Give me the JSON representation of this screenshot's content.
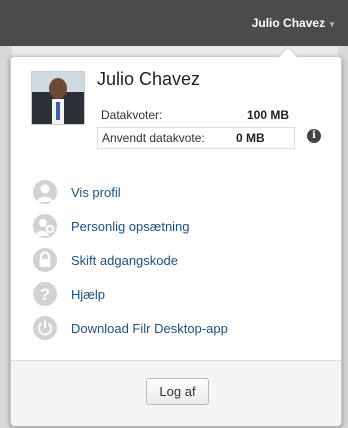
{
  "header": {
    "user_name": "Julio Chavez",
    "caret_icon": "chevron-down-icon"
  },
  "popup": {
    "user_name": "Julio Chavez",
    "avatar_icon": "user-photo",
    "quota": {
      "label": "Datakvoter:",
      "value": "100 MB"
    },
    "used_quota": {
      "label": "Anvendt datakvote:",
      "value": "0 MB"
    },
    "info_icon": "info-icon",
    "menu_items": [
      {
        "label": "Vis profil",
        "icon": "user-icon"
      },
      {
        "label": "Personlig opsætning",
        "icon": "user-settings-icon"
      },
      {
        "label": "Skift adgangskode",
        "icon": "lock-icon"
      },
      {
        "label": "Hjælp",
        "icon": "help-icon"
      },
      {
        "label": "Download Filr Desktop-app",
        "icon": "power-icon"
      }
    ],
    "logout_label": "Log af"
  },
  "colors": {
    "header_bg": "#4a4b4d",
    "link": "#1f4f86",
    "icon_gray": "#d2d2d2"
  }
}
